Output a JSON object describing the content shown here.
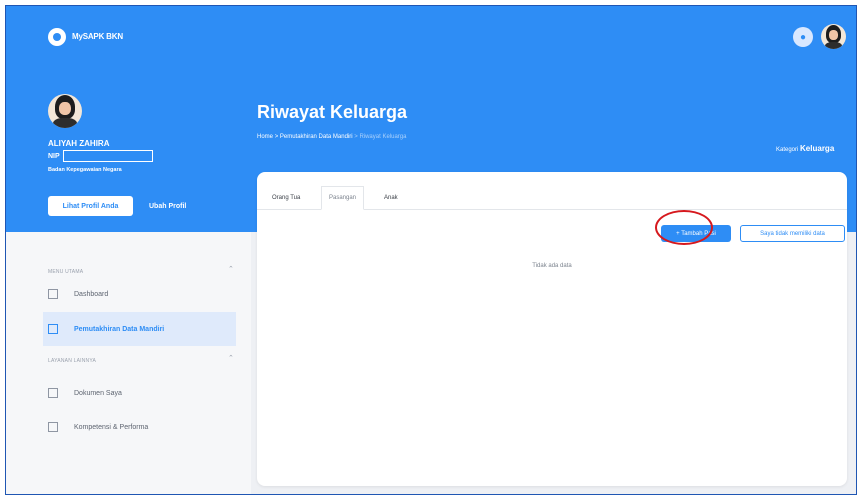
{
  "header": {
    "app_name": "MySAPK BKN",
    "notification_icon": "bell-icon"
  },
  "user": {
    "name": "ALIYAH ZAHIRA",
    "nip_label": "NIP",
    "agency": "Badan Kepegawaian Negara",
    "view_profile_label": "Lihat Profil Anda",
    "edit_profile_label": "Ubah Profil"
  },
  "sidebar": {
    "main_menu_heading": "MENU UTAMA",
    "service_menu_heading": "LAYANAN LAINNYA",
    "items": [
      {
        "label": "Dashboard",
        "icon": "dashboard-icon"
      },
      {
        "label": "Pemutakhiran Data Mandiri",
        "icon": "data-update-icon"
      },
      {
        "label": "Dokumen Saya",
        "icon": "document-icon"
      },
      {
        "label": "Kompetensi & Performa",
        "icon": "competence-icon"
      }
    ]
  },
  "page": {
    "title": "Riwayat Keluarga",
    "breadcrumb": {
      "home": "Home",
      "separator": ">",
      "parent": "Pemutakhiran Data Mandiri",
      "current": "Riwayat Keluarga"
    },
    "category_label": "Kategori",
    "category_value": "Keluarga",
    "tabs": [
      "Orang Tua",
      "Pasangan",
      "Anak"
    ],
    "add_button": "+ Tambah Pasangan",
    "add_button_visible": "+ Tambah Pasi",
    "no_data_button": "Saya tidak memiliki data",
    "empty_message": "Tidak ada data"
  },
  "colors": {
    "primary": "#2e8df5",
    "highlight_annotation": "#d6191e"
  }
}
